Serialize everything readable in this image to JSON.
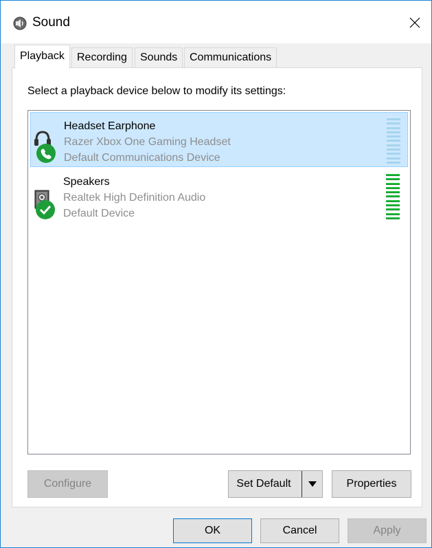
{
  "window": {
    "title": "Sound"
  },
  "tabs": [
    {
      "label": "Playback",
      "active": true
    },
    {
      "label": "Recording",
      "active": false
    },
    {
      "label": "Sounds",
      "active": false
    },
    {
      "label": "Communications",
      "active": false
    }
  ],
  "playback": {
    "instruction": "Select a playback device below to modify its settings:",
    "devices": [
      {
        "name": "Headset Earphone",
        "description": "Razer Xbox One Gaming Headset",
        "status": "Default Communications Device",
        "icon": "headset-icon",
        "badge": "phone-badge-icon",
        "selected": true,
        "level": 0
      },
      {
        "name": "Speakers",
        "description": "Realtek High Definition Audio",
        "status": "Default Device",
        "icon": "speaker-icon",
        "badge": "check-badge-icon",
        "selected": false,
        "level": 1
      }
    ],
    "buttons": {
      "configure": "Configure",
      "set_default": "Set Default",
      "properties": "Properties"
    }
  },
  "footer": {
    "ok": "OK",
    "cancel": "Cancel",
    "apply": "Apply"
  },
  "colors": {
    "accent": "#0078d7",
    "selection": "#cce8ff",
    "badge_green": "#1e9e3a",
    "meter_active": "#1fbf3a",
    "meter_idle": "#a6d4ee"
  }
}
